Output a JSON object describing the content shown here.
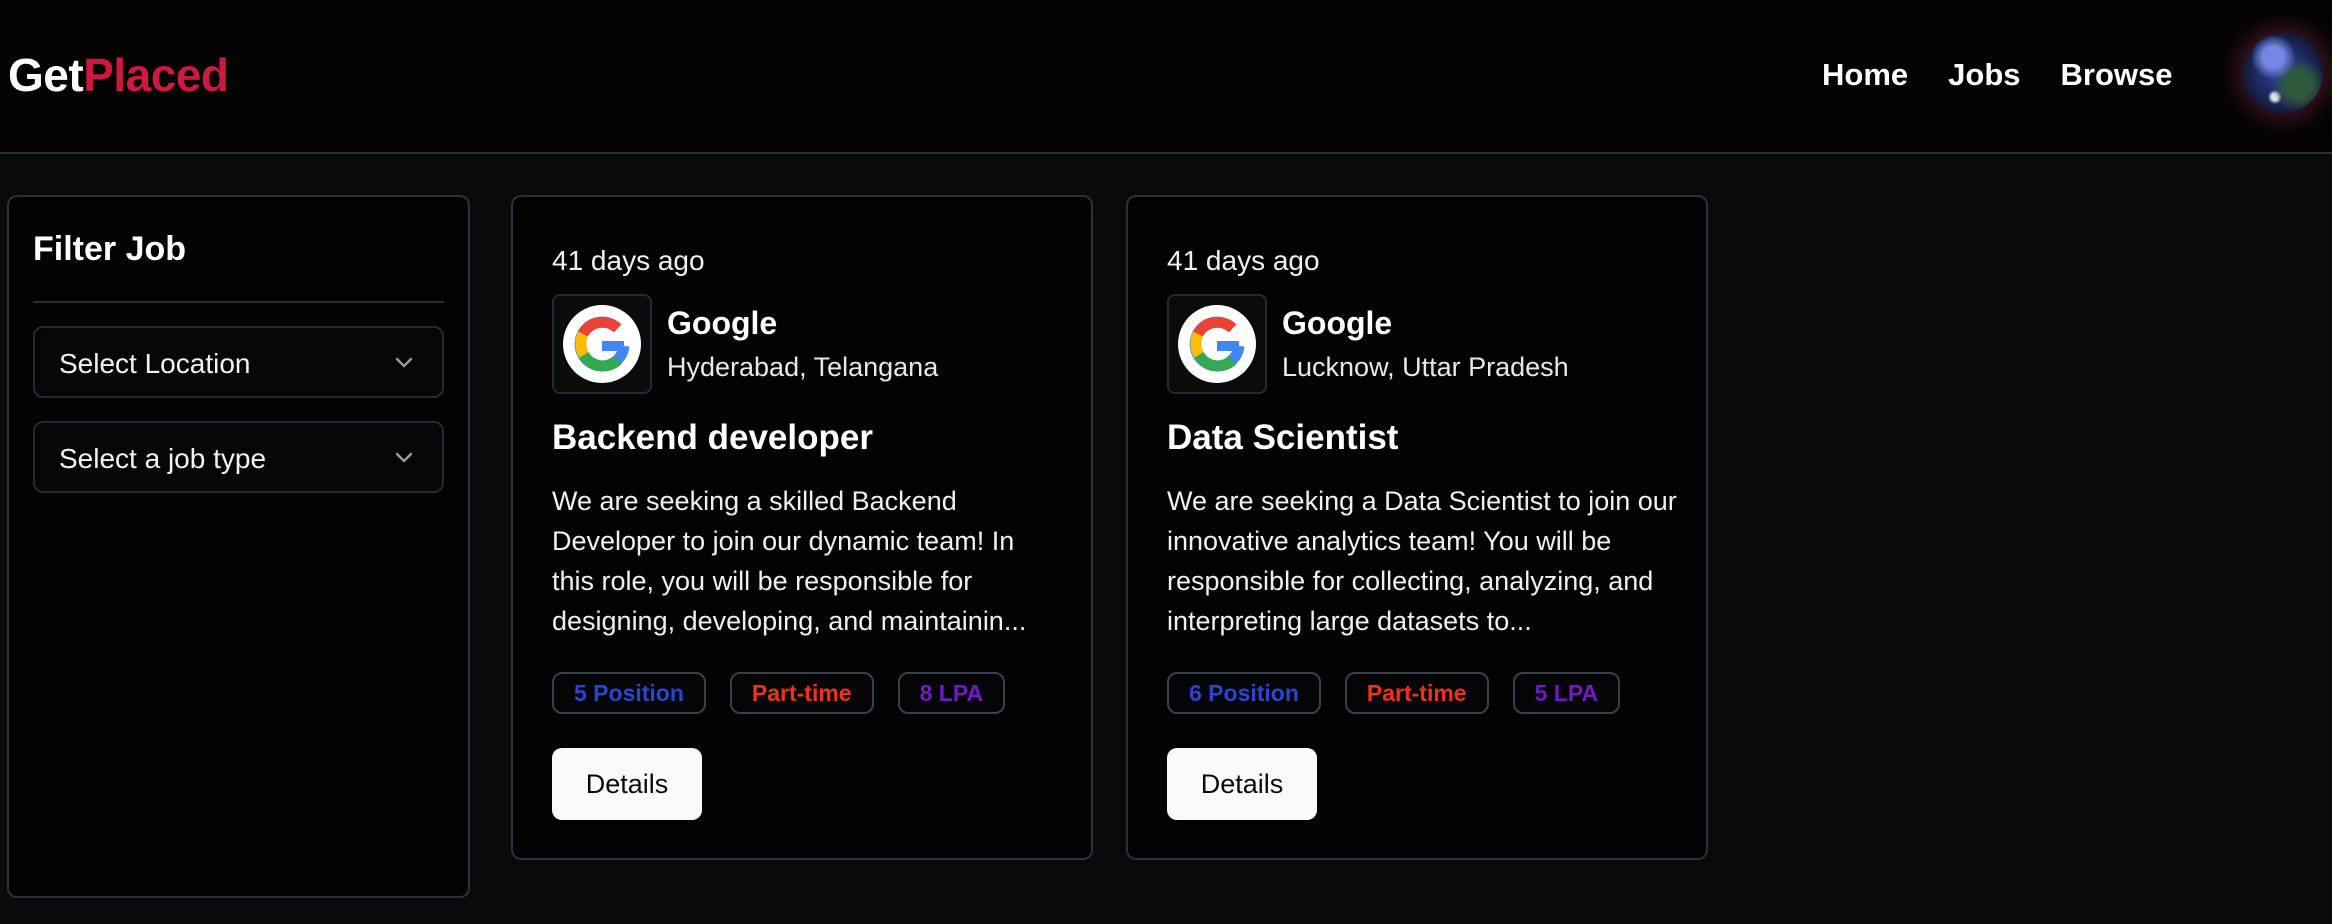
{
  "header": {
    "logo_part1": "Get",
    "logo_part2": "Placed",
    "nav": [
      "Home",
      "Jobs",
      "Browse"
    ]
  },
  "sidebar": {
    "title": "Filter Job",
    "location_select": "Select Location",
    "jobtype_select": "Select a job type"
  },
  "jobs": [
    {
      "posted": "41 days ago",
      "company": "Google",
      "location": "Hyderabad, Telangana",
      "title": "Backend developer",
      "description": "We are seeking a skilled Backend Developer to join our dynamic team! In this role, you will be responsible for designing, developing, and maintainin...",
      "positions": "5 Position",
      "job_type": "Part-time",
      "salary": "8 LPA",
      "button": "Details"
    },
    {
      "posted": "41 days ago",
      "company": "Google",
      "location": "Lucknow, Uttar Pradesh",
      "title": "Data Scientist",
      "description": "We are seeking a Data Scientist to join our innovative analytics team! You will be responsible for collecting, analyzing, and interpreting large datasets to...",
      "positions": "6 Position",
      "job_type": "Part-time",
      "salary": "5 LPA",
      "button": "Details"
    }
  ],
  "colors": {
    "brand_accent": "#d0173f",
    "position_tag": "#2a45d4",
    "jobtype_tag": "#f0321c",
    "salary_tag": "#7219c7"
  },
  "icons": {
    "company_logo": "google-logo-icon",
    "dropdown": "chevron-down-icon",
    "avatar": "user-avatar"
  }
}
